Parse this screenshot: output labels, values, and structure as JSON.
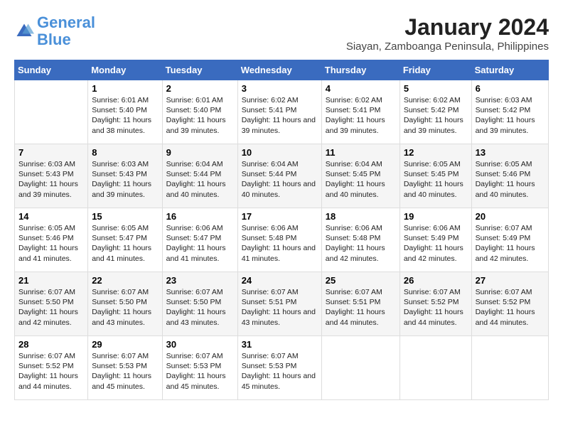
{
  "logo": {
    "line1": "General",
    "line2": "Blue"
  },
  "title": "January 2024",
  "subtitle": "Siayan, Zamboanga Peninsula, Philippines",
  "headers": [
    "Sunday",
    "Monday",
    "Tuesday",
    "Wednesday",
    "Thursday",
    "Friday",
    "Saturday"
  ],
  "weeks": [
    [
      {
        "day": "",
        "sunrise": "",
        "sunset": "",
        "daylight": ""
      },
      {
        "day": "1",
        "sunrise": "Sunrise: 6:01 AM",
        "sunset": "Sunset: 5:40 PM",
        "daylight": "Daylight: 11 hours and 38 minutes."
      },
      {
        "day": "2",
        "sunrise": "Sunrise: 6:01 AM",
        "sunset": "Sunset: 5:40 PM",
        "daylight": "Daylight: 11 hours and 39 minutes."
      },
      {
        "day": "3",
        "sunrise": "Sunrise: 6:02 AM",
        "sunset": "Sunset: 5:41 PM",
        "daylight": "Daylight: 11 hours and 39 minutes."
      },
      {
        "day": "4",
        "sunrise": "Sunrise: 6:02 AM",
        "sunset": "Sunset: 5:41 PM",
        "daylight": "Daylight: 11 hours and 39 minutes."
      },
      {
        "day": "5",
        "sunrise": "Sunrise: 6:02 AM",
        "sunset": "Sunset: 5:42 PM",
        "daylight": "Daylight: 11 hours and 39 minutes."
      },
      {
        "day": "6",
        "sunrise": "Sunrise: 6:03 AM",
        "sunset": "Sunset: 5:42 PM",
        "daylight": "Daylight: 11 hours and 39 minutes."
      }
    ],
    [
      {
        "day": "7",
        "sunrise": "Sunrise: 6:03 AM",
        "sunset": "Sunset: 5:43 PM",
        "daylight": "Daylight: 11 hours and 39 minutes."
      },
      {
        "day": "8",
        "sunrise": "Sunrise: 6:03 AM",
        "sunset": "Sunset: 5:43 PM",
        "daylight": "Daylight: 11 hours and 39 minutes."
      },
      {
        "day": "9",
        "sunrise": "Sunrise: 6:04 AM",
        "sunset": "Sunset: 5:44 PM",
        "daylight": "Daylight: 11 hours and 40 minutes."
      },
      {
        "day": "10",
        "sunrise": "Sunrise: 6:04 AM",
        "sunset": "Sunset: 5:44 PM",
        "daylight": "Daylight: 11 hours and 40 minutes."
      },
      {
        "day": "11",
        "sunrise": "Sunrise: 6:04 AM",
        "sunset": "Sunset: 5:45 PM",
        "daylight": "Daylight: 11 hours and 40 minutes."
      },
      {
        "day": "12",
        "sunrise": "Sunrise: 6:05 AM",
        "sunset": "Sunset: 5:45 PM",
        "daylight": "Daylight: 11 hours and 40 minutes."
      },
      {
        "day": "13",
        "sunrise": "Sunrise: 6:05 AM",
        "sunset": "Sunset: 5:46 PM",
        "daylight": "Daylight: 11 hours and 40 minutes."
      }
    ],
    [
      {
        "day": "14",
        "sunrise": "Sunrise: 6:05 AM",
        "sunset": "Sunset: 5:46 PM",
        "daylight": "Daylight: 11 hours and 41 minutes."
      },
      {
        "day": "15",
        "sunrise": "Sunrise: 6:05 AM",
        "sunset": "Sunset: 5:47 PM",
        "daylight": "Daylight: 11 hours and 41 minutes."
      },
      {
        "day": "16",
        "sunrise": "Sunrise: 6:06 AM",
        "sunset": "Sunset: 5:47 PM",
        "daylight": "Daylight: 11 hours and 41 minutes."
      },
      {
        "day": "17",
        "sunrise": "Sunrise: 6:06 AM",
        "sunset": "Sunset: 5:48 PM",
        "daylight": "Daylight: 11 hours and 41 minutes."
      },
      {
        "day": "18",
        "sunrise": "Sunrise: 6:06 AM",
        "sunset": "Sunset: 5:48 PM",
        "daylight": "Daylight: 11 hours and 42 minutes."
      },
      {
        "day": "19",
        "sunrise": "Sunrise: 6:06 AM",
        "sunset": "Sunset: 5:49 PM",
        "daylight": "Daylight: 11 hours and 42 minutes."
      },
      {
        "day": "20",
        "sunrise": "Sunrise: 6:07 AM",
        "sunset": "Sunset: 5:49 PM",
        "daylight": "Daylight: 11 hours and 42 minutes."
      }
    ],
    [
      {
        "day": "21",
        "sunrise": "Sunrise: 6:07 AM",
        "sunset": "Sunset: 5:50 PM",
        "daylight": "Daylight: 11 hours and 42 minutes."
      },
      {
        "day": "22",
        "sunrise": "Sunrise: 6:07 AM",
        "sunset": "Sunset: 5:50 PM",
        "daylight": "Daylight: 11 hours and 43 minutes."
      },
      {
        "day": "23",
        "sunrise": "Sunrise: 6:07 AM",
        "sunset": "Sunset: 5:50 PM",
        "daylight": "Daylight: 11 hours and 43 minutes."
      },
      {
        "day": "24",
        "sunrise": "Sunrise: 6:07 AM",
        "sunset": "Sunset: 5:51 PM",
        "daylight": "Daylight: 11 hours and 43 minutes."
      },
      {
        "day": "25",
        "sunrise": "Sunrise: 6:07 AM",
        "sunset": "Sunset: 5:51 PM",
        "daylight": "Daylight: 11 hours and 44 minutes."
      },
      {
        "day": "26",
        "sunrise": "Sunrise: 6:07 AM",
        "sunset": "Sunset: 5:52 PM",
        "daylight": "Daylight: 11 hours and 44 minutes."
      },
      {
        "day": "27",
        "sunrise": "Sunrise: 6:07 AM",
        "sunset": "Sunset: 5:52 PM",
        "daylight": "Daylight: 11 hours and 44 minutes."
      }
    ],
    [
      {
        "day": "28",
        "sunrise": "Sunrise: 6:07 AM",
        "sunset": "Sunset: 5:52 PM",
        "daylight": "Daylight: 11 hours and 44 minutes."
      },
      {
        "day": "29",
        "sunrise": "Sunrise: 6:07 AM",
        "sunset": "Sunset: 5:53 PM",
        "daylight": "Daylight: 11 hours and 45 minutes."
      },
      {
        "day": "30",
        "sunrise": "Sunrise: 6:07 AM",
        "sunset": "Sunset: 5:53 PM",
        "daylight": "Daylight: 11 hours and 45 minutes."
      },
      {
        "day": "31",
        "sunrise": "Sunrise: 6:07 AM",
        "sunset": "Sunset: 5:53 PM",
        "daylight": "Daylight: 11 hours and 45 minutes."
      },
      {
        "day": "",
        "sunrise": "",
        "sunset": "",
        "daylight": ""
      },
      {
        "day": "",
        "sunrise": "",
        "sunset": "",
        "daylight": ""
      },
      {
        "day": "",
        "sunrise": "",
        "sunset": "",
        "daylight": ""
      }
    ]
  ]
}
